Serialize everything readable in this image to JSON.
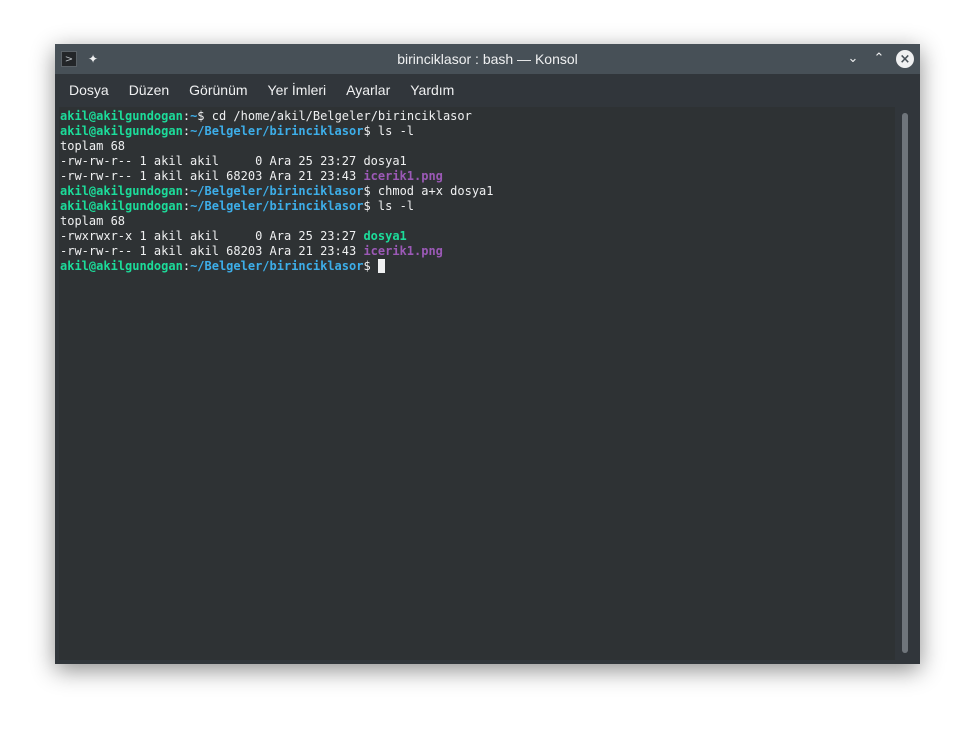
{
  "window": {
    "title": "birinciklasor : bash — Konsol"
  },
  "menubar": {
    "items": [
      "Dosya",
      "Düzen",
      "Görünüm",
      "Yer İmleri",
      "Ayarlar",
      "Yardım"
    ]
  },
  "terminal": {
    "user_host": "akil@akilgundogan",
    "lines": [
      {
        "type": "prompt",
        "path": "~",
        "cmd": " cd /home/akil/Belgeler/birinciklasor"
      },
      {
        "type": "prompt",
        "path": "~/Belgeler/birinciklasor",
        "cmd": " ls -l"
      },
      {
        "type": "text",
        "text": "toplam 68"
      },
      {
        "type": "file",
        "prefix": "-rw-rw-r-- 1 akil akil     0 Ara 25 23:27 ",
        "name": "dosya1",
        "kind": "plain"
      },
      {
        "type": "file",
        "prefix": "-rw-rw-r-- 1 akil akil 68203 Ara 21 23:43 ",
        "name": "icerik1.png",
        "kind": "image"
      },
      {
        "type": "prompt",
        "path": "~/Belgeler/birinciklasor",
        "cmd": " chmod a+x dosya1"
      },
      {
        "type": "prompt",
        "path": "~/Belgeler/birinciklasor",
        "cmd": " ls -l"
      },
      {
        "type": "text",
        "text": "toplam 68"
      },
      {
        "type": "file",
        "prefix": "-rwxrwxr-x 1 akil akil     0 Ara 25 23:27 ",
        "name": "dosya1",
        "kind": "exec"
      },
      {
        "type": "file",
        "prefix": "-rw-rw-r-- 1 akil akil 68203 Ara 21 23:43 ",
        "name": "icerik1.png",
        "kind": "image"
      },
      {
        "type": "prompt",
        "path": "~/Belgeler/birinciklasor",
        "cmd": " ",
        "cursor": true
      }
    ]
  },
  "icons": {
    "app": "terminal-app-icon",
    "pin": "pin-icon",
    "minimize": "chevron-down-icon",
    "maximize": "chevron-up-icon",
    "close": "close-icon"
  },
  "colors": {
    "user": "#1cdc9a",
    "path": "#3daee9",
    "image": "#9b59b6",
    "exec": "#1cdc9a",
    "background": "#2e3234"
  }
}
